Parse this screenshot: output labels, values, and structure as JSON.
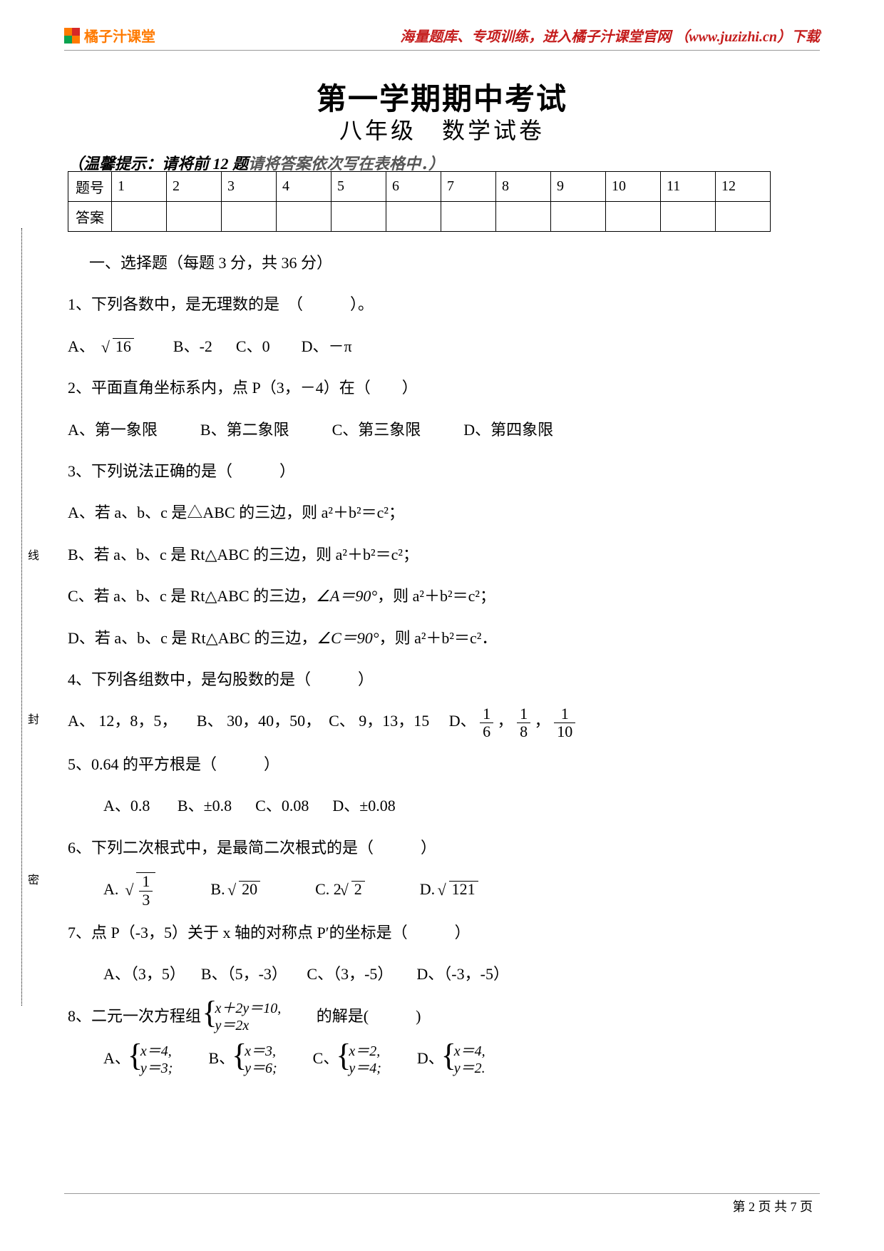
{
  "header": {
    "brand": "橘子汁课堂",
    "link": "海量题库、专项训练，进入橘子汁课堂官网 （www.juzizhi.cn）下载"
  },
  "title": {
    "line1": "第一学期期中考试",
    "line2": "八年级　数学试卷"
  },
  "hint": {
    "prefix": "（温馨提示：请将前 12 题",
    "suffix": "请将答案依次写在表格中．）"
  },
  "table": {
    "row1": "题号",
    "row2": "答案",
    "nums": [
      "1",
      "2",
      "3",
      "4",
      "5",
      "6",
      "7",
      "8",
      "9",
      "10",
      "11",
      "12"
    ]
  },
  "section1": "一、选择题（每题 3 分，共 36 分）",
  "q1": {
    "stem": "1、下列各数中，是无理数的是　（　　　）。",
    "A_pre": "A、",
    "A_val": "16",
    "B": "B、-2",
    "C": "C、0",
    "D": "D、－π"
  },
  "q2": {
    "stem": "2、平面直角坐标系内，点 P（3，－4）在（　　）",
    "A": "A、第一象限",
    "B": "B、第二象限",
    "C": "C、第三象限",
    "D": "D、第四象限"
  },
  "q3": {
    "stem": "3、下列说法正确的是（　　　）",
    "A": "A、若 a、b、c 是△ABC 的三边，则 a²＋b²＝c²；",
    "B": "B、若 a、b、c 是 Rt△ABC 的三边，则 a²＋b²＝c²；",
    "C_pre": "C、若 a、b、c 是 Rt△ABC 的三边，",
    "C_ang": "∠A＝90°",
    "C_suf": "，则 a²＋b²＝c²；",
    "D_pre": "D、若 a、b、c 是 Rt△ABC 的三边，",
    "D_ang": "∠C＝90°",
    "D_suf": "，则 a²＋b²＝c²．"
  },
  "q4": {
    "stem": "4、下列各组数中，是勾股数的是（　　　）",
    "A": "A、 12，8，5，",
    "B": "B、 30，40，50，",
    "C": "C、 9，13，15",
    "D_pre": "D、",
    "f1n": "1",
    "f1d": "6",
    "sep": "，",
    "f2n": "1",
    "f2d": "8",
    "f3n": "1",
    "f3d": "10"
  },
  "q5": {
    "stem": "5、0.64 的平方根是（　　　）",
    "A": "A、0.8",
    "B": "B、±0.8",
    "C": "C、0.08",
    "D": "D、±0.08"
  },
  "q6": {
    "stem": "6、下列二次根式中，是最简二次根式的是（　　　）",
    "A_lbl": "A.",
    "A_n": "1",
    "A_d": "3",
    "B_lbl": "B.",
    "B_val": "20",
    "C_lbl": "C.",
    "C_pre": "2",
    "C_val": "2",
    "D_lbl": "D.",
    "D_val": "121"
  },
  "q7": {
    "stem": "7、点 P（-3，5）关于 x 轴的对称点 P′的坐标是（　　　）",
    "A": "A、（3，5）",
    "B": "B、（5，-3）",
    "C": "C、（3，-5）",
    "D": "D、（-3，-5）"
  },
  "q8": {
    "stem_pre": "8、二元一次方程组",
    "sys1": "x＋2y＝10,",
    "sys2": "y＝2x",
    "stem_suf": "　　的解是(　　　)",
    "A_lbl": "A、",
    "A1": "x＝4,",
    "A2": "y＝3;",
    "B_lbl": "B、",
    "B1": "x＝3,",
    "B2": "y＝6;",
    "C_lbl": "C、",
    "C1": "x＝2,",
    "C2": "y＝4;",
    "D_lbl": "D、",
    "D1": "x＝4,",
    "D2": "y＝2."
  },
  "margin": {
    "t1": "线",
    "t2": "封",
    "t3": "密"
  },
  "footer": {
    "text": "第 2 页 共 7 页"
  }
}
